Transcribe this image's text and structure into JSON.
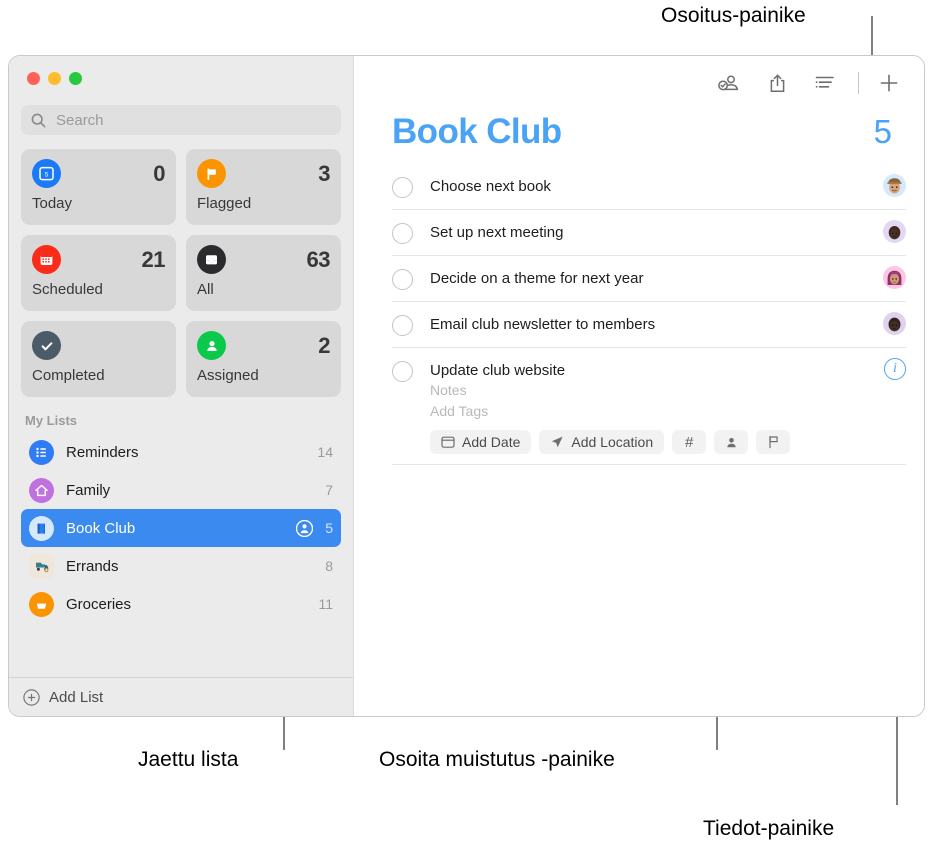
{
  "annotations": [
    {
      "id": "pointer-button",
      "text": "Osoitus-painike"
    },
    {
      "id": "shared-list",
      "text": "Jaettu lista"
    },
    {
      "id": "assign-reminder",
      "text": "Osoita muistutus -painike"
    },
    {
      "id": "info-button",
      "text": "Tiedot-painike"
    }
  ],
  "window": {
    "traffic_lights": [
      "close",
      "minimize",
      "zoom"
    ]
  },
  "sidebar": {
    "search": {
      "placeholder": "Search",
      "value": "",
      "icon": "search-icon"
    },
    "tiles": [
      {
        "label": "Today",
        "count": "0",
        "icon": "calendar-day-icon",
        "color": "#1a7af8"
      },
      {
        "label": "Flagged",
        "count": "3",
        "icon": "flag-icon",
        "color": "#fa9500"
      },
      {
        "label": "Scheduled",
        "count": "21",
        "icon": "calendar-icon",
        "color": "#fa2b18"
      },
      {
        "label": "All",
        "count": "63",
        "icon": "inbox-icon",
        "color": "#2b2b2e"
      },
      {
        "label": "Completed",
        "count": "",
        "icon": "checkmark-icon",
        "color": "#4b5c68"
      },
      {
        "label": "Assigned",
        "count": "2",
        "icon": "person-icon",
        "color": "#0bc94a"
      }
    ],
    "section_header": "My Lists",
    "lists": [
      {
        "label": "Reminders",
        "count": "14",
        "icon": "list-bullet-icon",
        "color": "#2f7cf6",
        "selected": false,
        "shared": false
      },
      {
        "label": "Family",
        "count": "7",
        "icon": "house-icon",
        "color": "#c170e0",
        "selected": false,
        "shared": false
      },
      {
        "label": "Book Club",
        "count": "5",
        "icon": "book-icon",
        "color": "#d6e9fb",
        "selected": true,
        "shared": true
      },
      {
        "label": "Errands",
        "count": "8",
        "icon": "truck-icon",
        "color": "#efe7dc",
        "selected": false,
        "shared": false
      },
      {
        "label": "Groceries",
        "count": "11",
        "icon": "basket-icon",
        "color": "#fa9500",
        "selected": false,
        "shared": false
      }
    ],
    "add_list": {
      "label": "Add List",
      "icon": "plus-circle-icon"
    }
  },
  "main": {
    "toolbar": [
      {
        "id": "assign",
        "icon": "person-badge-check-icon"
      },
      {
        "id": "share",
        "icon": "share-icon"
      },
      {
        "id": "sort",
        "icon": "list-view-icon"
      },
      {
        "id": "add",
        "icon": "plus-icon"
      }
    ],
    "title": "Book Club",
    "total": "5",
    "accent_color": "#4ba3f5",
    "reminders": [
      {
        "text": "Choose next book",
        "avatar": "memoji-hat",
        "avatar_bg": "#d4eafc",
        "selected": false
      },
      {
        "text": "Set up next meeting",
        "avatar": "memoji-dark",
        "avatar_bg": "#e3d7f2",
        "selected": false
      },
      {
        "text": "Decide on a theme for next year",
        "avatar": "memoji-pink",
        "avatar_bg": "#fbc8e0",
        "selected": false
      },
      {
        "text": "Email club newsletter to members",
        "avatar": "memoji-dark2",
        "avatar_bg": "#ded2ef",
        "selected": false
      },
      {
        "text": "Update club website",
        "avatar": "info-button",
        "avatar_bg": "",
        "selected": true,
        "notes_placeholder": "Notes",
        "tags_placeholder": "Add Tags",
        "chips": [
          {
            "id": "add-date",
            "label": "Add Date",
            "icon": "calendar-small-icon"
          },
          {
            "id": "add-location",
            "label": "Add Location",
            "icon": "location-arrow-icon"
          },
          {
            "id": "add-tag",
            "label": "#",
            "icon": "hash-icon"
          },
          {
            "id": "assign-to",
            "label": "",
            "icon": "person-fill-icon"
          },
          {
            "id": "flag",
            "label": "",
            "icon": "flag-outline-icon"
          }
        ]
      }
    ]
  }
}
